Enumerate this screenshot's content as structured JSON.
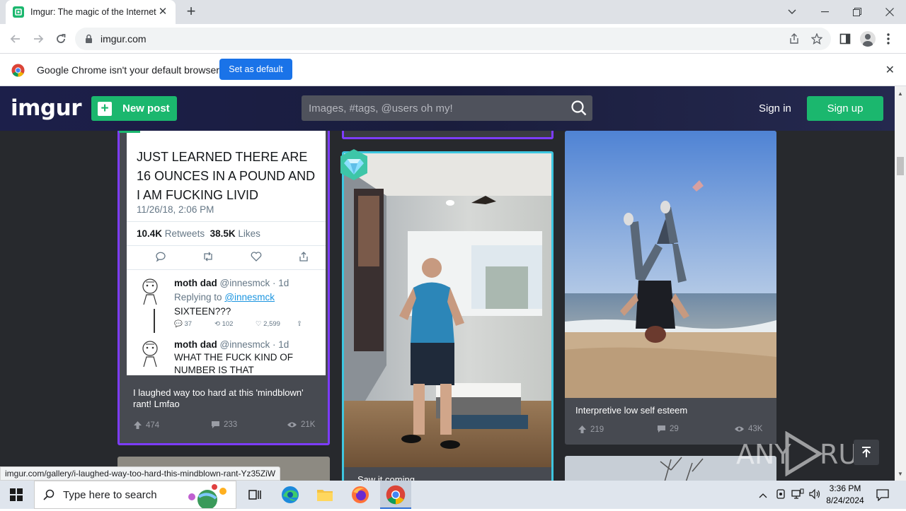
{
  "browser": {
    "tab_title": "Imgur: The magic of the Internet",
    "url": "imgur.com",
    "infobar_text": "Google Chrome isn't your default browser",
    "set_default_label": "Set as default",
    "status_url": "imgur.com/gallery/i-laughed-way-too-hard-this-mindblown-rant-Yz35ZiW"
  },
  "header": {
    "logo": "imgur",
    "new_post_label": "New post",
    "search_placeholder": "Images, #tags, @users oh my!",
    "sign_in_label": "Sign in",
    "sign_up_label": "Sign up"
  },
  "posts": [
    {
      "title": "I laughed way too hard at this 'mindblown' rant! Lmfao",
      "upvotes": "474",
      "comments": "233",
      "views": "21K",
      "tweet": {
        "text": "JUST LEARNED THERE ARE 16 OUNCES IN A POUND AND I AM FUCKING LIVID",
        "timestamp": "11/26/18, 2:06 PM",
        "retweets_count": "10.4K",
        "retweets_label": "Retweets",
        "likes_count": "38.5K",
        "likes_label": "Likes",
        "reply1_name": "moth dad",
        "reply1_handle": "@innesmck · 1d",
        "reply1_replying": "Replying to",
        "reply1_mention": "@innesmck",
        "reply1_text": "SIXTEEN???",
        "reply1_replies": "37",
        "reply1_retweets": "102",
        "reply1_likes": "2,599",
        "reply2_name": "moth dad",
        "reply2_handle": "@innesmck · 1d",
        "reply2_text": "WHAT THE FUCK KIND OF NUMBER IS THAT"
      }
    },
    {
      "title": "Saw it coming"
    },
    {
      "title": "Interpretive low self esteem",
      "upvotes": "219",
      "comments": "29",
      "views": "43K"
    }
  ],
  "watermark": "ANY RUN",
  "taskbar": {
    "search_placeholder": "Type here to search",
    "time": "3:36 PM",
    "date": "8/24/2024"
  },
  "colors": {
    "imgur_green": "#1bb76e",
    "purple_border": "#7d3cff",
    "teal_border": "#3ec6e0",
    "chrome_blue": "#1a73e8"
  }
}
